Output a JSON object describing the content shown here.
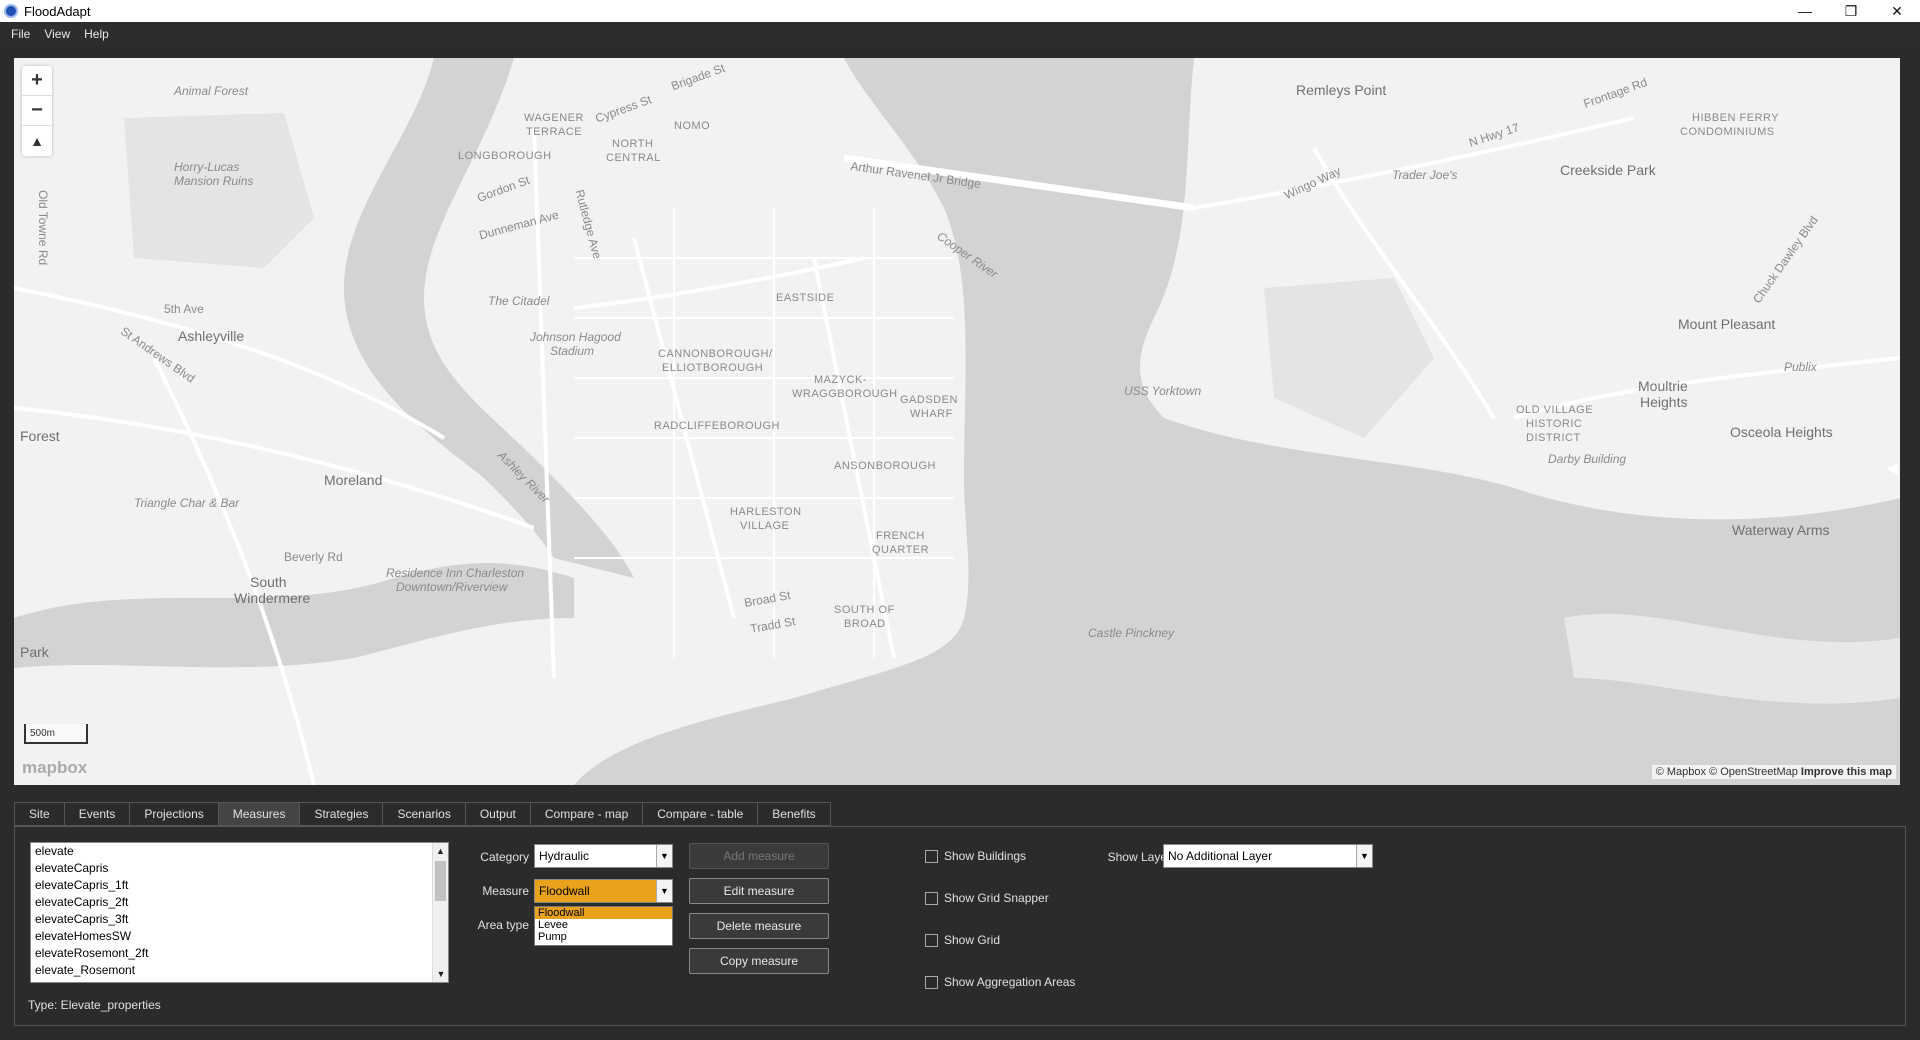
{
  "window": {
    "title": "FloodAdapt",
    "minimize": "—",
    "maximize": "❐",
    "close": "✕"
  },
  "menu": [
    "File",
    "View",
    "Help"
  ],
  "map": {
    "zoom_in": "+",
    "zoom_out": "−",
    "compass": "▲",
    "scale": "500m",
    "logo": "mapbox",
    "attribution": "© Mapbox © OpenStreetMap",
    "improve": "Improve this map",
    "collapse": "◀",
    "labels": {
      "animal_forest": "Animal Forest",
      "horry_lucas": "Horry-Lucas",
      "mansion_ruins": "Mansion Ruins",
      "old_towne_rd": "Old Towne Rd",
      "ashleyville": "Ashleyville",
      "st_andrews": "St Andrews Blvd",
      "fifth_ave": "5th Ave",
      "moreland": "Moreland",
      "forest": "Forest",
      "triangle": "Triangle Char & Bar",
      "beverly": "Beverly Rd",
      "south_windermere_1": "South",
      "south_windermere_2": "Windermere",
      "park": "Park",
      "wagener": "WAGENER",
      "terrace": "TERRACE",
      "nomo": "NOMO",
      "north": "NORTH",
      "central": "CENTRAL",
      "longborough": "LONGBOROUGH",
      "cypress": "Cypress St",
      "brigade": "Brigade St",
      "gordon": "Gordon St",
      "dunneman": "Dunneman Ave",
      "rutledge": "Rutledge Ave",
      "the_citadel": "The Citadel",
      "hagood_1": "Johnson Hagood",
      "hagood_2": "Stadium",
      "eastside": "EASTSIDE",
      "cannonborough_1": "CANNONBOROUGH/",
      "cannonborough_2": "ELLIOTBOROUGH",
      "mazyck_1": "MAZYCK-",
      "mazyck_2": "WRAGGBOROUGH",
      "gadsden_1": "GADSDEN",
      "gadsden_2": "WHARF",
      "radcliffe": "RADCLIFFEBOROUGH",
      "ansonborough": "ANSONBOROUGH",
      "harleston_1": "HARLESTON",
      "harleston_2": "VILLAGE",
      "french_1": "FRENCH",
      "french_2": "QUARTER",
      "south_broad_1": "SOUTH OF",
      "south_broad_2": "BROAD",
      "broad": "Broad St",
      "tradd": "Tradd St",
      "residence_1": "Residence Inn Charleston",
      "residence_2": "Downtown/Riverview",
      "ashley_river": "Ashley River",
      "cooper_river": "Cooper River",
      "bridge": "Arthur Ravenel Jr Bridge",
      "uss_yorktown": "USS Yorktown",
      "castle_pinckney": "Castle Pinckney",
      "remleys": "Remleys Point",
      "hwy17": "N Hwy 17",
      "frontage": "Frontage Rd",
      "hibben_1": "HIBBEN FERRY",
      "hibben_2": "CONDOMINIUMS",
      "creekside": "Creekside Park",
      "trader_joes": "Trader Joe's",
      "wingo": "Wingo Way",
      "mount_pleasant": "Mount Pleasant",
      "moultrie_1": "Moultrie",
      "moultrie_2": "Heights",
      "old_village_1": "OLD VILLAGE",
      "old_village_2": "HISTORIC",
      "old_village_3": "DISTRICT",
      "osceola": "Osceola Heights",
      "darby": "Darby Building",
      "waterway": "Waterway Arms",
      "publix": "Publix",
      "chuck_dawley": "Chuck Dawley Blvd"
    }
  },
  "tabs": [
    "Site",
    "Events",
    "Projections",
    "Measures",
    "Strategies",
    "Scenarios",
    "Output",
    "Compare - map",
    "Compare - table",
    "Benefits"
  ],
  "active_tab": "Measures",
  "measures": {
    "list": [
      "elevate",
      "elevateCapris",
      "elevateCapris_1ft",
      "elevateCapris_2ft",
      "elevateCapris_3ft",
      "elevateHomesSW",
      "elevateRosemont_2ft",
      "elevate_Rosemont"
    ],
    "type_text": "Type: Elevate_properties",
    "category_label": "Category",
    "category_value": "Hydraulic",
    "measure_label": "Measure",
    "measure_value": "Floodwall",
    "area_type_label": "Area type",
    "dropdown_options": [
      "Floodwall",
      "Levee",
      "Pump"
    ],
    "buttons": {
      "add": "Add measure",
      "edit": "Edit measure",
      "delete": "Delete measure",
      "copy": "Copy measure"
    },
    "checks": {
      "buildings": "Show Buildings",
      "grid_snapper": "Show Grid Snapper",
      "grid": "Show Grid",
      "aggregation": "Show Aggregation Areas"
    },
    "show_layer_label": "Show Layer",
    "show_layer_value": "No Additional Layer"
  },
  "colors": {
    "accent": "#e8a21b",
    "water": "#d3d3d3",
    "land": "#f2f2f2",
    "park": "#e6e6e6"
  }
}
